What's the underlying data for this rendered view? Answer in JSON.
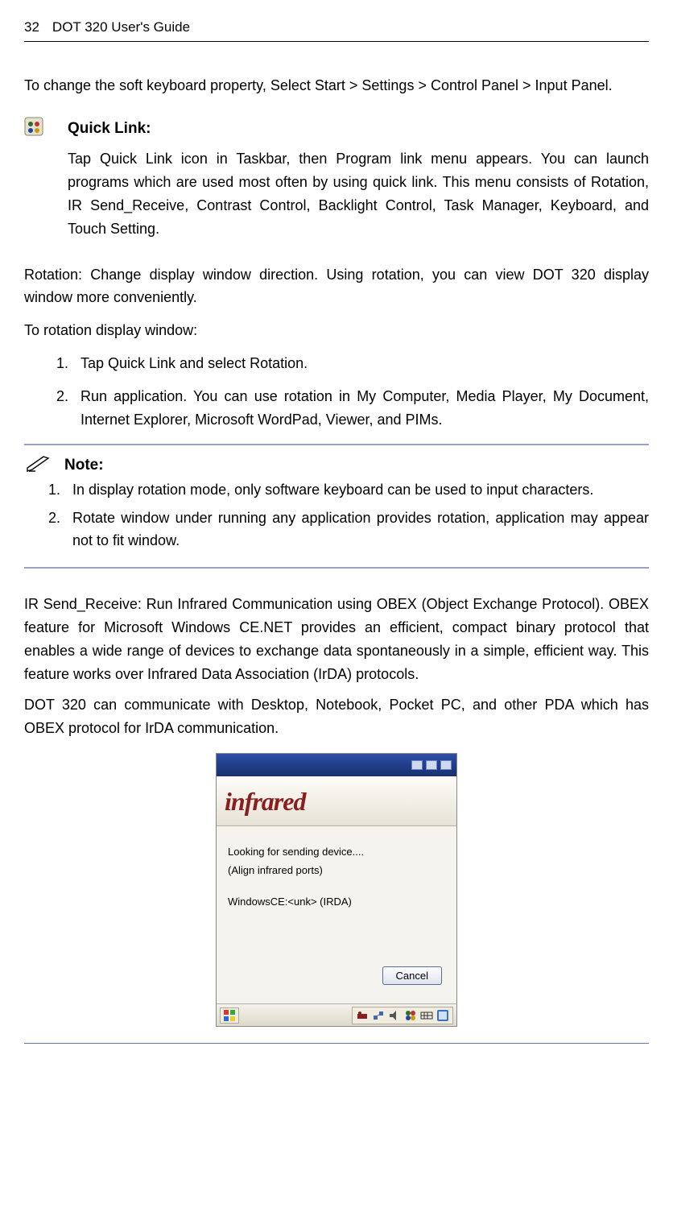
{
  "header": {
    "page_number": "32",
    "doc_title": "DOT 320 User's Guide"
  },
  "intro_paragraph": "To change the soft keyboard property, Select Start > Settings > Control Panel > Input Panel.",
  "quick_link": {
    "icon_name": "quick-link-icon",
    "heading": "Quick Link:",
    "body": "Tap Quick Link icon in Taskbar, then Program link menu appears. You can launch programs which are used most often by using quick link. This menu consists of Rotation, IR Send_Receive, Contrast Control, Backlight Control, Task Manager, Keyboard, and Touch Setting."
  },
  "rotation": {
    "desc": "Rotation: Change display window direction. Using rotation, you can view DOT 320 display window more conveniently.",
    "subhead": "To rotation display window:",
    "steps": [
      "Tap Quick Link and select Rotation.",
      "Run application. You can use rotation in My Computer, Media Player, My Document, Internet Explorer, Microsoft WordPad, Viewer, and PIMs."
    ]
  },
  "note": {
    "label": "Note:",
    "items": [
      "In display rotation mode, only software keyboard can be used to input characters.",
      "Rotate window under running any application provides rotation, application may appear not to fit window."
    ]
  },
  "ir_section": {
    "p1": "IR Send_Receive: Run Infrared Communication using OBEX (Object Exchange Protocol). OBEX feature for Microsoft Windows CE.NET provides an efficient, compact binary protocol that enables a wide range of devices to exchange data spontaneously in a simple, efficient way. This feature works over Infrared Data Association (IrDA) protocols.",
    "p2": "DOT 320 can communicate with Desktop, Notebook, Pocket PC, and other PDA which has OBEX protocol for IrDA communication."
  },
  "screenshot": {
    "logo_text": "infrared",
    "line1": "Looking for sending device....",
    "line2": "(Align infrared ports)",
    "line3": "WindowsCE:<unk> (IRDA)",
    "cancel_label": "Cancel"
  }
}
